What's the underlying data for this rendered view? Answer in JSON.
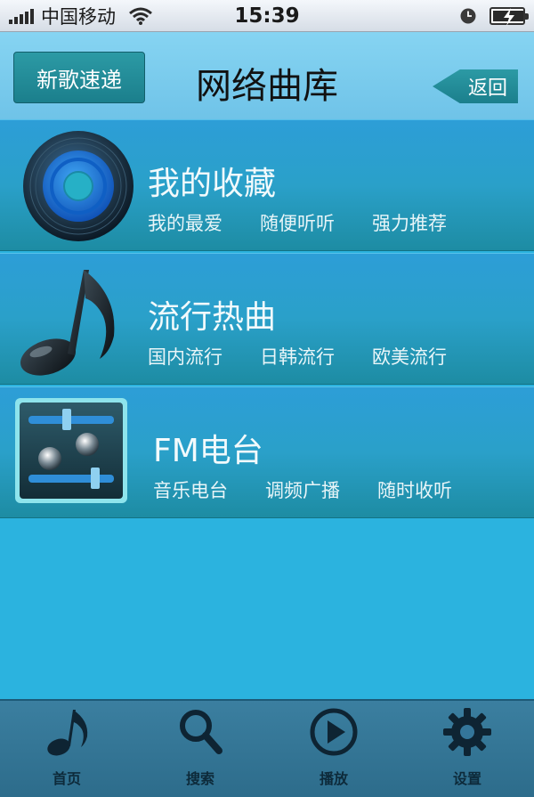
{
  "status_bar": {
    "carrier": "中国移动",
    "time": "15:39"
  },
  "header": {
    "new_songs_label": "新歌速递",
    "title": "网络曲库",
    "back_label": "返回"
  },
  "menu": {
    "items": [
      {
        "icon": "vinyl-disc-icon",
        "title": "我的收藏",
        "subs": [
          "我的最爱",
          "随便听听",
          "强力推荐"
        ]
      },
      {
        "icon": "music-note-icon",
        "title": "流行热曲",
        "subs": [
          "国内流行",
          "日韩流行",
          "欧美流行"
        ]
      },
      {
        "icon": "radio-equalizer-icon",
        "title": "FM电台",
        "subs": [
          "音乐电台",
          "调频广播",
          "随时收听"
        ]
      }
    ]
  },
  "tab_bar": {
    "items": [
      {
        "icon": "music-note-icon",
        "label": "首页"
      },
      {
        "icon": "search-icon",
        "label": "搜索"
      },
      {
        "icon": "play-icon",
        "label": "播放"
      },
      {
        "icon": "gear-icon",
        "label": "设置"
      }
    ]
  },
  "colors": {
    "background": "#2bb3df",
    "header": "#7fcdef",
    "card": "#2aa0c9",
    "button": "#238b97",
    "tab_bar": "#34769a"
  }
}
